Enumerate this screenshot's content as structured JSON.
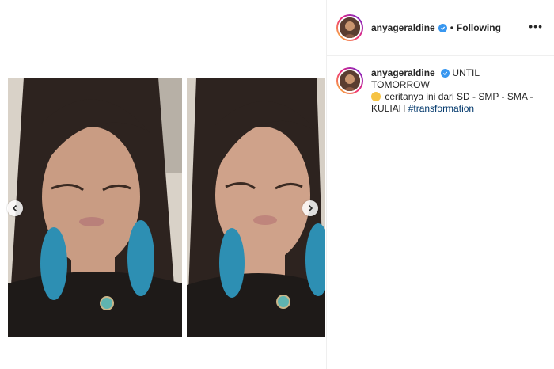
{
  "post": {
    "username": "anyageraldine",
    "separator": "•",
    "follow_status": "Following",
    "more_glyph": "•••"
  },
  "caption": {
    "username": "anyageraldine",
    "line1": "UNTIL TOMORROW",
    "line2": "ceritanya ini dari SD - SMP - SMA - KULIAH",
    "hashtag": "#transformation"
  },
  "carousel": {
    "prev_icon": "chevron-left-icon",
    "next_icon": "chevron-right-icon"
  },
  "colors": {
    "verified_blue": "#3897f0",
    "hashtag_blue": "#00376b",
    "story_ring": [
      "#f9ce34",
      "#ee2a7b",
      "#6228d7"
    ]
  }
}
